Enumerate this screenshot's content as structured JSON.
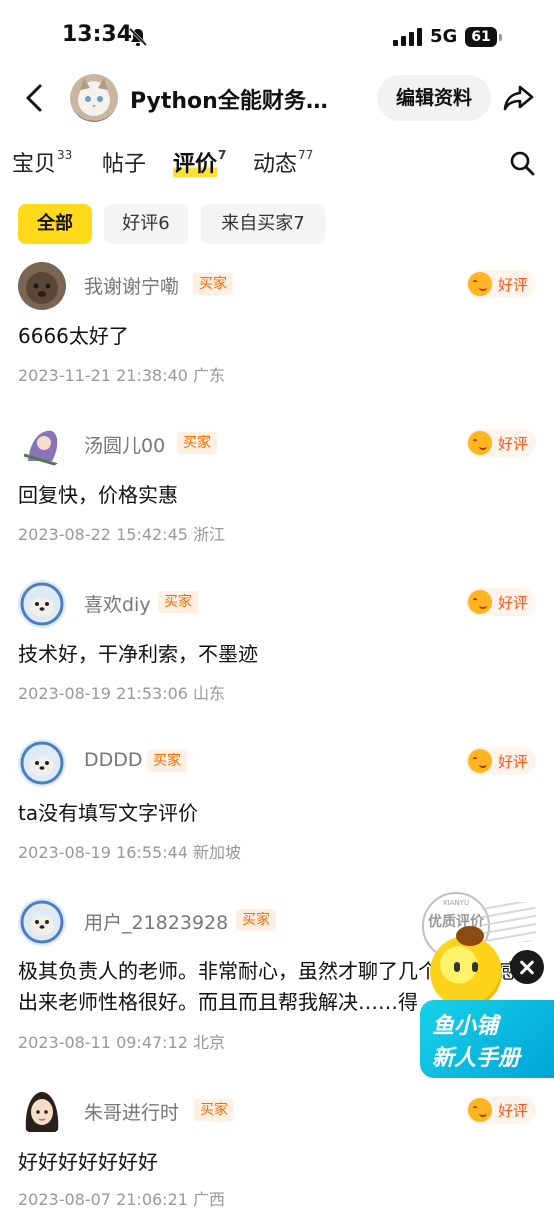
{
  "status_bar": {
    "time": "13:34",
    "network": "5G",
    "battery": "61"
  },
  "header": {
    "shop_name": "Python全能财务…",
    "edit_button": "编辑资料"
  },
  "tabs": [
    {
      "label": "宝贝",
      "count": "33"
    },
    {
      "label": "帖子",
      "count": ""
    },
    {
      "label": "评价",
      "count": "7"
    },
    {
      "label": "动态",
      "count": "77"
    }
  ],
  "filters": [
    {
      "label": "全部"
    },
    {
      "label": "好评6"
    },
    {
      "label": "来自买家7"
    }
  ],
  "buyer_badge": "买家",
  "good_label": "好评",
  "reviews": [
    {
      "user": "我谢谢宁嘞",
      "text": "6666太好了",
      "time": "2023-11-21 21:38:40",
      "region": "广东"
    },
    {
      "user": "汤圆儿00",
      "text": "回复快，价格实惠",
      "time": "2023-08-22 15:42:45",
      "region": "浙江"
    },
    {
      "user": "喜欢diy",
      "text": "技术好，干净利索，不墨迹",
      "time": "2023-08-19 21:53:06",
      "region": "山东"
    },
    {
      "user": "DDDD",
      "text": "ta没有填写文字评价",
      "time": "2023-08-19 16:55:44",
      "region": "新加坡"
    },
    {
      "user": "用户_21823928",
      "text": "极其负责人的老师。非常耐心，虽然才聊了几个……是感觉出来老师性格很好。而且而且帮我解决……得",
      "time": "2023-08-11 09:47:12",
      "region": "北京"
    },
    {
      "user": "朱哥进行时",
      "text": "好好好好好好好",
      "time": "2023-08-07 21:06:21",
      "region": "广西"
    }
  ],
  "promo": {
    "stamp_top": "XIANYU",
    "stamp_text": "优质评价",
    "line1": "鱼小铺",
    "line2": "新人手册"
  }
}
